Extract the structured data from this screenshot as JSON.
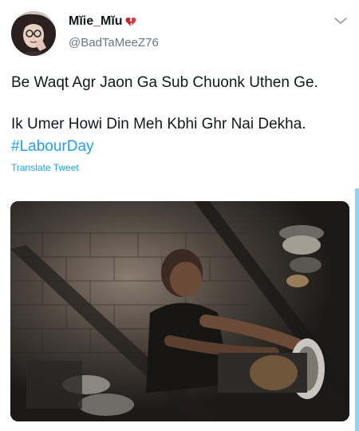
{
  "user": {
    "display_name": "Mĭie_Mĭu",
    "handle": "@BadTaMeeZ76"
  },
  "tweet": {
    "line1": "Be Waqt Agr Jaon Ga Sub Chuonk Uthen Ge.",
    "line2": "Ik Umer Howi Din Meh Kbhi Ghr Nai Dekha.",
    "hashtag": "#LabourDay",
    "translate_label": "Translate Tweet"
  },
  "icons": {
    "caret": "chevron-down-icon",
    "emoji": "broken-heart-icon"
  },
  "colors": {
    "link": "#1da1f2",
    "secondary_text": "#657786",
    "scrollbar": "#8fd3f7"
  }
}
